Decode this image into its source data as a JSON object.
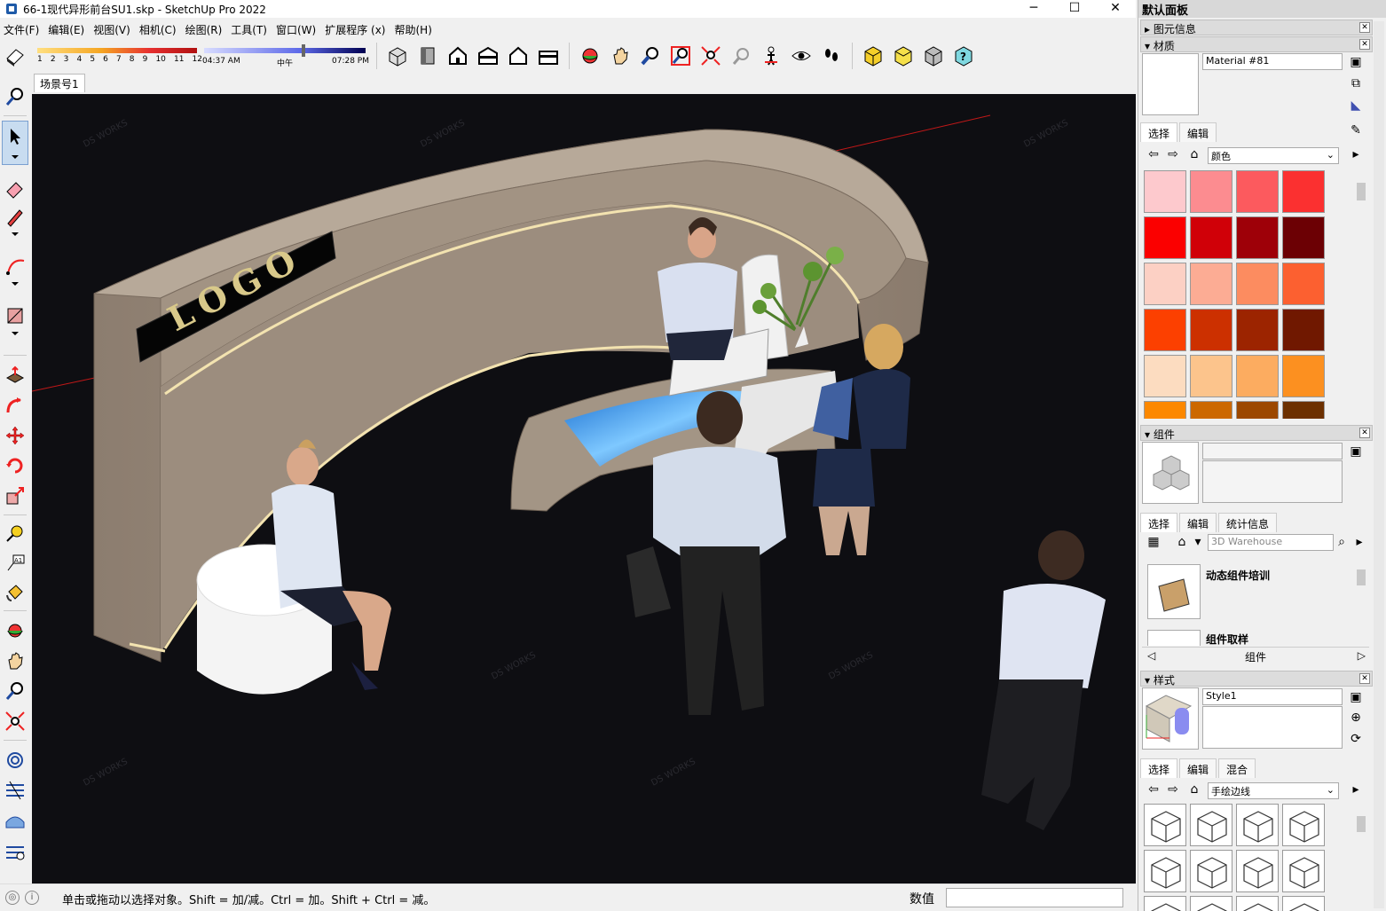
{
  "window": {
    "title": "66-1现代异形前台SU1.skp - SketchUp Pro 2022",
    "minimize": "─",
    "maximize": "☐",
    "close": "✕"
  },
  "menu": [
    "文件(F)",
    "编辑(E)",
    "视图(V)",
    "相机(C)",
    "绘图(R)",
    "工具(T)",
    "窗口(W)",
    "扩展程序 (x)",
    "帮助(H)"
  ],
  "shadow": {
    "months": [
      "1",
      "2",
      "3",
      "4",
      "5",
      "6",
      "7",
      "8",
      "9",
      "10",
      "11",
      "12"
    ],
    "time_start": "04:37 AM",
    "time_mid": "中午",
    "time_end": "07:28 PM"
  },
  "scene_tab": "场景号1",
  "status": {
    "message": "单击或拖动以选择对象。Shift = 加/减。Ctrl = 加。Shift + Ctrl = 减。",
    "value_label": "数值",
    "value": ""
  },
  "tray": {
    "title": "默认面板",
    "entity_info": "图元信息",
    "materials": {
      "header": "材质",
      "name": "Material #81",
      "tab_select": "选择",
      "tab_edit": "编辑",
      "library": "颜色",
      "swatches": [
        "#fdc9cd",
        "#fc8c90",
        "#fc5a5e",
        "#fb3030",
        "#fb0000",
        "#d00008",
        "#9e0008",
        "#6c0004",
        "#fcd0c4",
        "#fcac94",
        "#fc8c60",
        "#fc6030",
        "#fc4000",
        "#cc3000",
        "#9c2400",
        "#701800",
        "#fcdcc0",
        "#fcc48c",
        "#fcac60",
        "#fc9020",
        "#fc8800",
        "#cc6800",
        "#9c4800",
        "#6c3000"
      ]
    },
    "components": {
      "header": "组件",
      "tab_select": "选择",
      "tab_edit": "编辑",
      "tab_stats": "统计信息",
      "search_placeholder": "3D Warehouse",
      "items": [
        "动态组件培训",
        "组件取样"
      ],
      "footer": "组件"
    },
    "styles": {
      "header": "样式",
      "name": "Style1",
      "tab_select": "选择",
      "tab_edit": "编辑",
      "tab_mix": "混合",
      "library": "手绘边线"
    }
  },
  "scene": {
    "logo_text": "LOGO",
    "watermark": "DS WORKS"
  },
  "colors": {
    "viewport_bg": "#0e0e12",
    "wall": "#9a8b7c",
    "wall_top": "#b3a597",
    "light_strip": "#f3e3b0"
  }
}
